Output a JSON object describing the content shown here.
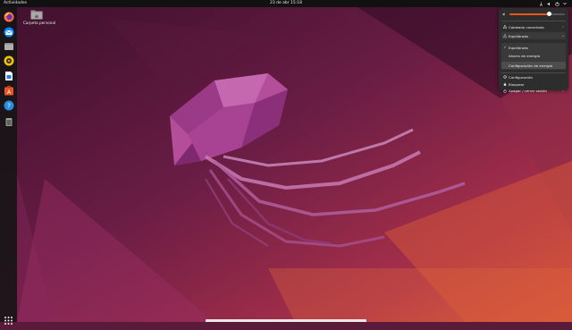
{
  "topbar": {
    "activities": "Actividades",
    "clock": "23 de abr 15:18"
  },
  "dock": {
    "items": [
      {
        "name": "firefox-icon",
        "color": "#ff7139"
      },
      {
        "name": "thunderbird-icon",
        "color": "#0a84ff"
      },
      {
        "name": "files-icon",
        "color": "#8a8a8a"
      },
      {
        "name": "rhythmbox-icon",
        "color": "#f5c400"
      },
      {
        "name": "writer-icon",
        "color": "#2a7fd6"
      },
      {
        "name": "software-icon",
        "color": "#e95420"
      },
      {
        "name": "help-icon",
        "color": "#2a8de0"
      },
      {
        "name": "trash-icon",
        "color": "#9aa19a"
      }
    ],
    "show_apps_icon": "grid-icon"
  },
  "desktop": {
    "home_folder_label": "Carpeta personal"
  },
  "system_menu": {
    "volume_level": 0.72,
    "wired": "Cableado conectado",
    "power_mode": "Equilibrado",
    "power_options": [
      "Equilibrado",
      "Ahorro de energía",
      "Configuración de energía"
    ],
    "settings": "Configuración",
    "lock": "Bloquear",
    "power_off": "Apagar / cerrar sesión"
  },
  "colors": {
    "accent": "#e95420",
    "menu_bg": "#2d2d2d",
    "topbar_bg": "#111111"
  }
}
